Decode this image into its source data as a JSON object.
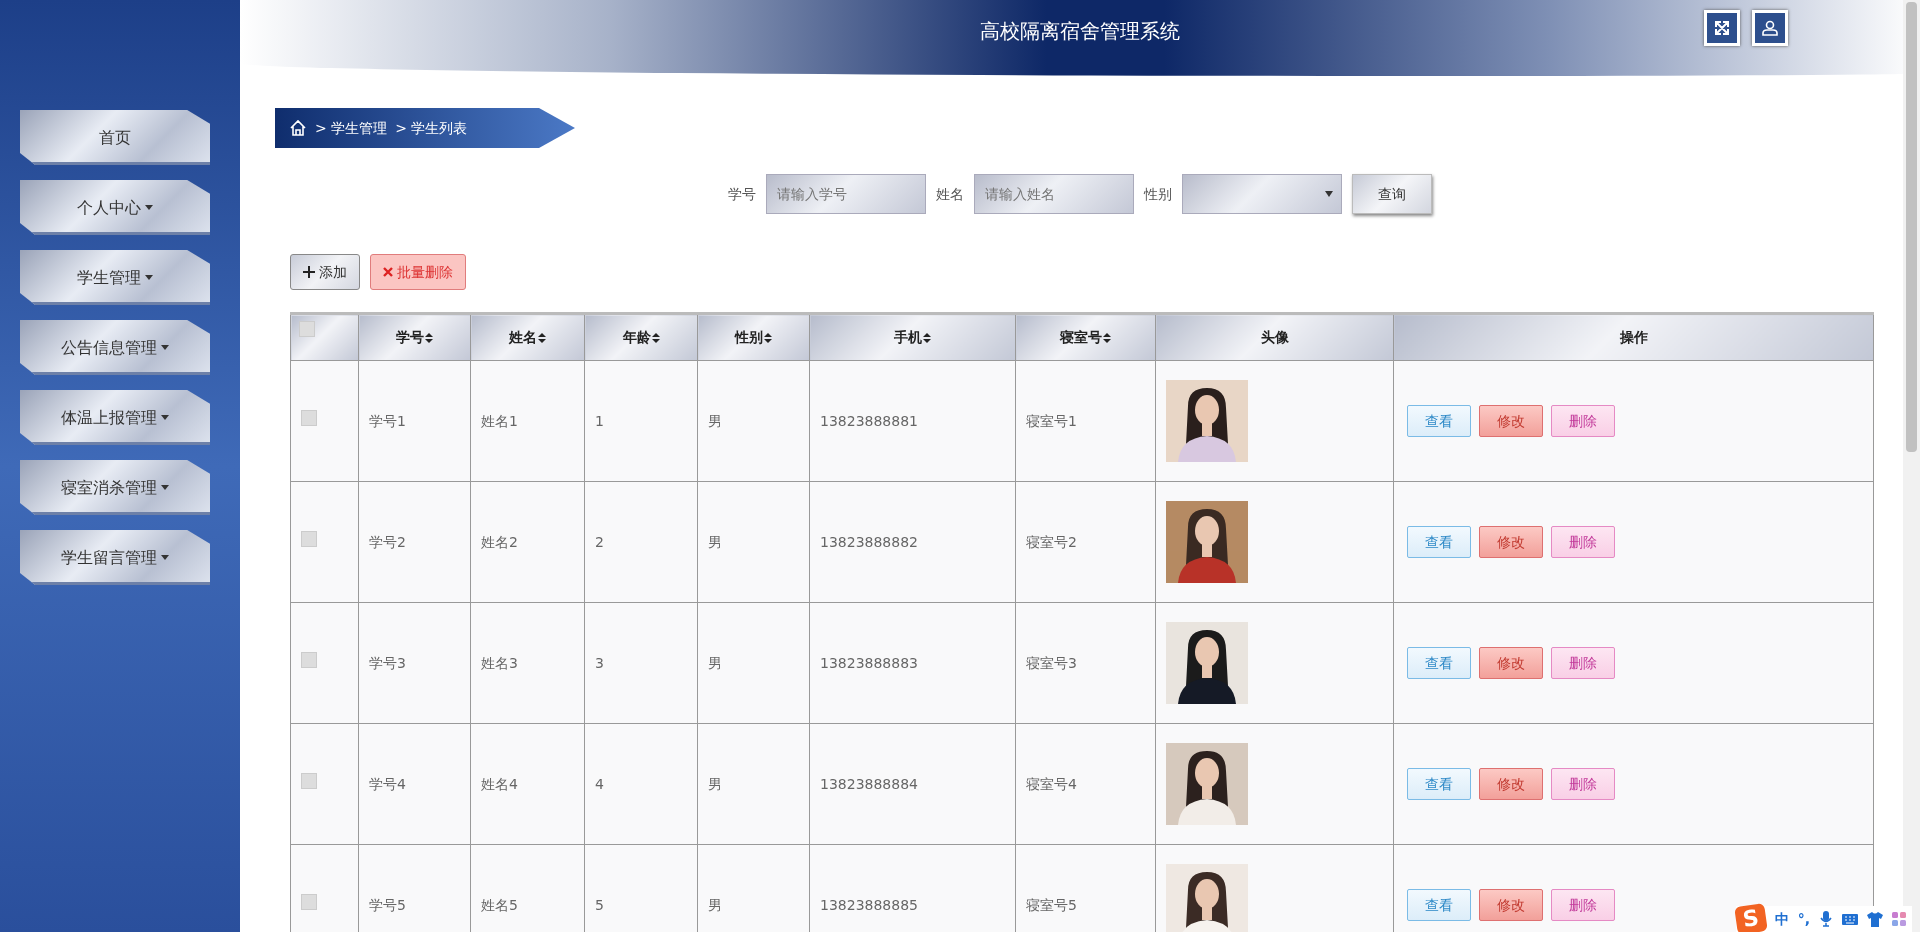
{
  "header": {
    "title": "高校隔离宿舍管理系统"
  },
  "sidebar": {
    "items": [
      {
        "label": "首页",
        "has_menu": false
      },
      {
        "label": "个人中心",
        "has_menu": true
      },
      {
        "label": "学生管理",
        "has_menu": true
      },
      {
        "label": "公告信息管理",
        "has_menu": true
      },
      {
        "label": "体温上报管理",
        "has_menu": true
      },
      {
        "label": "寝室消杀管理",
        "has_menu": true
      },
      {
        "label": "学生留言管理",
        "has_menu": true
      }
    ]
  },
  "breadcrumb": [
    {
      "separator": ">",
      "label": "学生管理"
    },
    {
      "separator": ">",
      "label": "学生列表"
    }
  ],
  "search": {
    "fields": [
      {
        "label": "学号",
        "kind": "input",
        "placeholder": "请输入学号"
      },
      {
        "label": "姓名",
        "kind": "input",
        "placeholder": "请输入姓名"
      },
      {
        "label": "性别",
        "kind": "select"
      }
    ],
    "button": "查询"
  },
  "actions": [
    {
      "kind": "add",
      "label": "添加"
    },
    {
      "kind": "delete",
      "label": "批量删除"
    }
  ],
  "table": {
    "select_all_checked": false,
    "columns": [
      {
        "label": "学号",
        "sortable": true
      },
      {
        "label": "姓名",
        "sortable": true
      },
      {
        "label": "年龄",
        "sortable": true
      },
      {
        "label": "性别",
        "sortable": true
      },
      {
        "label": "手机",
        "sortable": true
      },
      {
        "label": "寝室号",
        "sortable": true
      },
      {
        "label": "头像",
        "sortable": false
      },
      {
        "label": "操作",
        "sortable": false
      }
    ],
    "rows": [
      {
        "checked": false,
        "cells": [
          "学号1",
          "姓名1",
          "1",
          "男",
          "13823888881",
          "寝室号1"
        ],
        "buttons": [
          {
            "kind": "view",
            "label": "查看"
          },
          {
            "kind": "edit",
            "label": "修改"
          },
          {
            "kind": "delete",
            "label": "删除"
          }
        ]
      },
      {
        "checked": false,
        "cells": [
          "学号2",
          "姓名2",
          "2",
          "男",
          "13823888882",
          "寝室号2"
        ],
        "buttons": [
          {
            "kind": "view",
            "label": "查看"
          },
          {
            "kind": "edit",
            "label": "修改"
          },
          {
            "kind": "delete",
            "label": "删除"
          }
        ]
      },
      {
        "checked": false,
        "cells": [
          "学号3",
          "姓名3",
          "3",
          "男",
          "13823888883",
          "寝室号3"
        ],
        "buttons": [
          {
            "kind": "view",
            "label": "查看"
          },
          {
            "kind": "edit",
            "label": "修改"
          },
          {
            "kind": "delete",
            "label": "删除"
          }
        ]
      },
      {
        "checked": false,
        "cells": [
          "学号4",
          "姓名4",
          "4",
          "男",
          "13823888884",
          "寝室号4"
        ],
        "buttons": [
          {
            "kind": "view",
            "label": "查看"
          },
          {
            "kind": "edit",
            "label": "修改"
          },
          {
            "kind": "delete",
            "label": "删除"
          }
        ]
      },
      {
        "checked": false,
        "cells": [
          "学号5",
          "姓名5",
          "5",
          "男",
          "13823888885",
          "寝室号5"
        ],
        "buttons": [
          {
            "kind": "view",
            "label": "查看"
          },
          {
            "kind": "edit",
            "label": "修改"
          },
          {
            "kind": "delete",
            "label": "删除"
          }
        ]
      }
    ]
  },
  "ime": {
    "logo": "S",
    "items": [
      "中",
      "°,"
    ]
  }
}
